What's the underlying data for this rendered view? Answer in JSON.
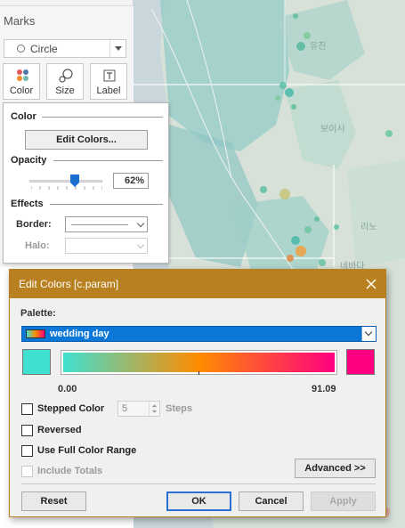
{
  "marks": {
    "title": "Marks",
    "mark_type": "Circle",
    "buttons": {
      "color": "Color",
      "size": "Size",
      "label": "Label"
    }
  },
  "color_popover": {
    "color_section": "Color",
    "edit_colors_button": "Edit Colors...",
    "opacity_section": "Opacity",
    "opacity_value": "62%",
    "opacity_fraction": 0.62,
    "effects_section": "Effects",
    "border_label": "Border:",
    "halo_label": "Halo:"
  },
  "map": {
    "labels": {
      "city1": "유진",
      "city2": "보이시",
      "city3": "리노",
      "city4": "네바다"
    }
  },
  "dialog": {
    "title": "Edit Colors [c.param]",
    "palette_label": "Palette:",
    "palette_name": "wedding day",
    "gradient_colors": {
      "start": "#40e0d0",
      "middle": "#ff8c00",
      "end": "#ff0080"
    },
    "range_min": "0.00",
    "range_max": "91.09",
    "stepped_color_label": "Stepped Color",
    "steps_value": "5",
    "steps_label": "Steps",
    "reversed_label": "Reversed",
    "full_range_label": "Use Full Color Range",
    "include_totals_label": "Include Totals",
    "advanced_button": "Advanced >>",
    "reset_button": "Reset",
    "ok_button": "OK",
    "cancel_button": "Cancel",
    "apply_button": "Apply"
  },
  "colors": {
    "title_bar": "#b8801e",
    "palette_highlight": "#0b78d7"
  }
}
